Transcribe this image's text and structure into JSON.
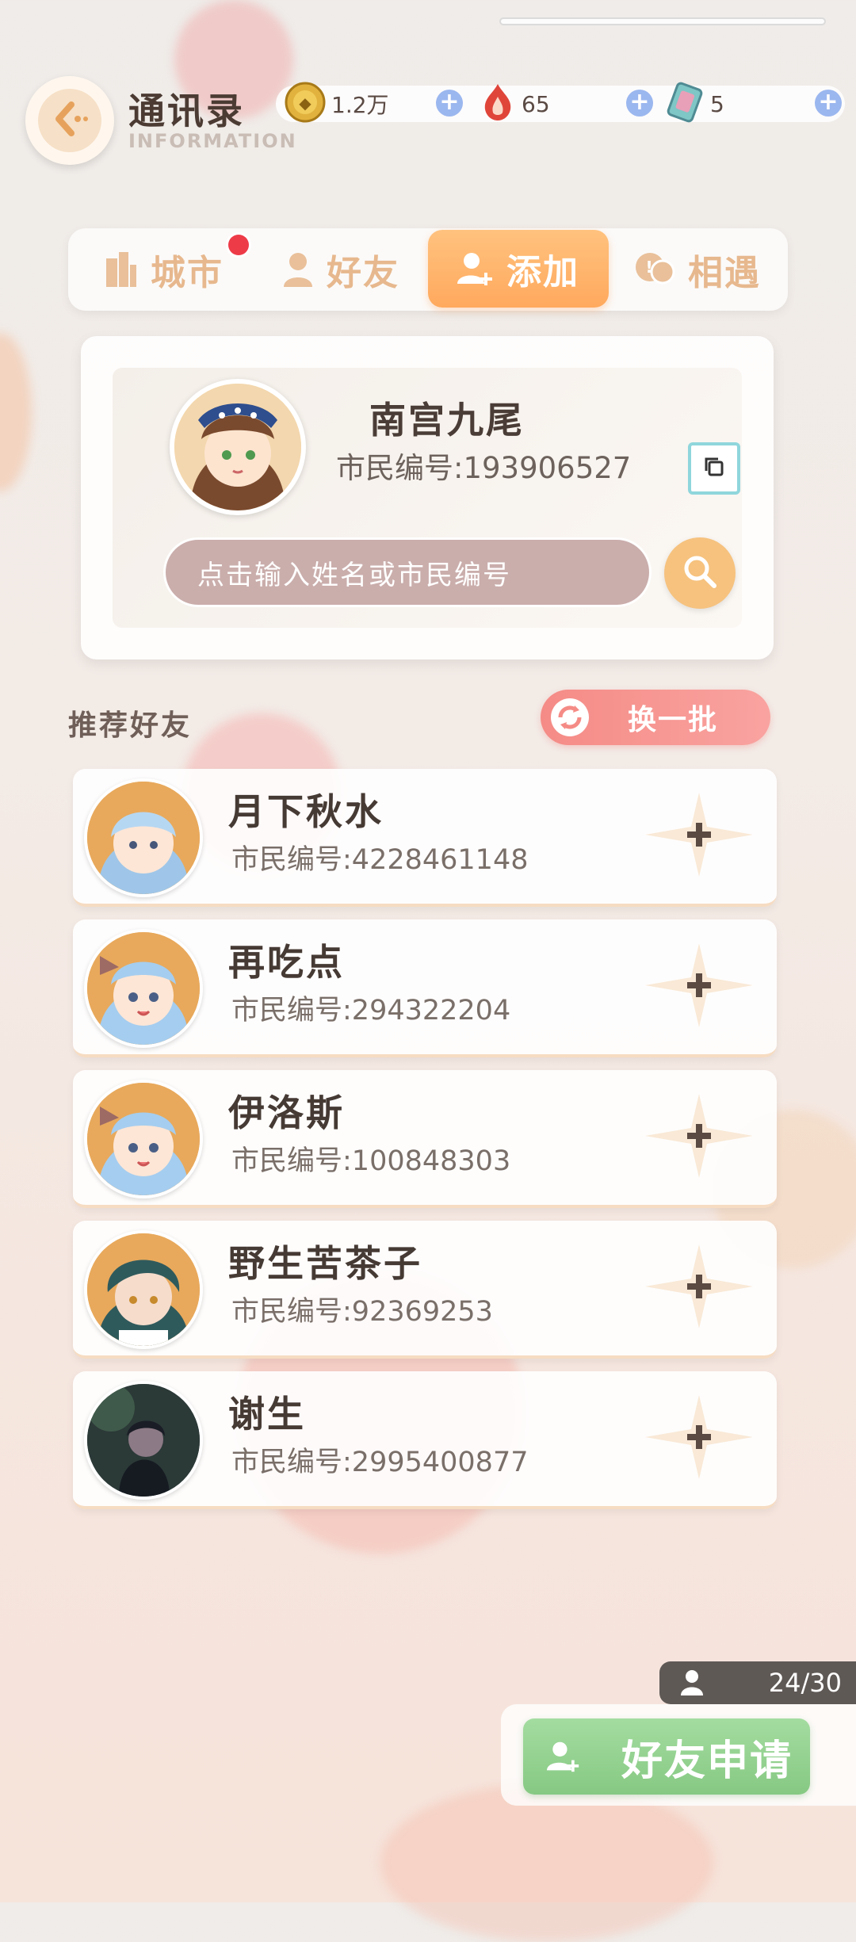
{
  "header": {
    "title": "通讯录",
    "subtitle": "INFORMATION"
  },
  "currencies": [
    {
      "icon": "gold-coin-icon",
      "value": "1.2万"
    },
    {
      "icon": "red-crystal-icon",
      "value": "65"
    },
    {
      "icon": "ticket-card-icon",
      "value": "5"
    }
  ],
  "tabs": [
    {
      "label": "城市",
      "icon": "city-building-icon",
      "badge": true
    },
    {
      "label": "好友",
      "icon": "person-icon"
    },
    {
      "label": "添加",
      "icon": "add-person-icon",
      "active": true
    },
    {
      "label": "相遇",
      "icon": "chat-bubble-icon"
    }
  ],
  "profile": {
    "name": "南宫九尾",
    "id_label": "市民编号:",
    "id": "193906527"
  },
  "search": {
    "placeholder": "点击输入姓名或市民编号"
  },
  "recommend": {
    "title": "推荐好友",
    "refresh_label": "换一批",
    "friends": [
      {
        "name": "月下秋水",
        "id_label": "市民编号:",
        "id": "4228461148"
      },
      {
        "name": "再吃点",
        "id_label": "市民编号:",
        "id": "294322204"
      },
      {
        "name": "伊洛斯",
        "id_label": "市民编号:",
        "id": "100848303"
      },
      {
        "name": "野生苦茶子",
        "id_label": "市民编号:",
        "id": "92369253"
      },
      {
        "name": "谢生",
        "id_label": "市民编号:",
        "id": "2995400877"
      }
    ]
  },
  "friend_count": "24/30",
  "apply_button_label": "好友申请",
  "colors": {
    "accent_orange": "#ffa95e",
    "badge_red": "#ee3b48",
    "apply_green": "#86c983",
    "refresh_pink": "#f58b86"
  }
}
